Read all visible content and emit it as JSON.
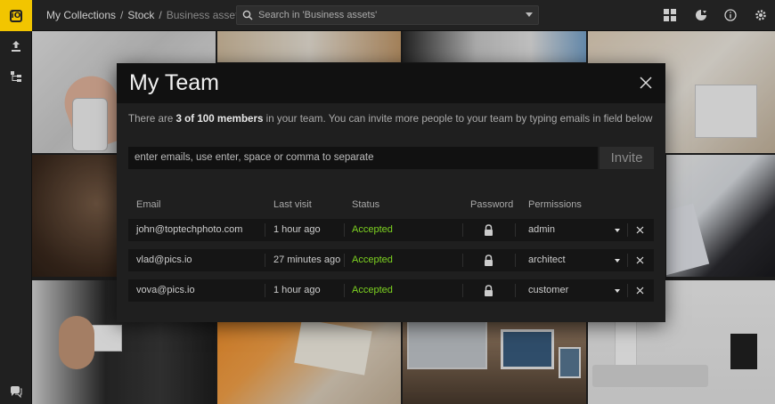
{
  "topbar": {
    "logo_text": "iO",
    "breadcrumb": [
      "My Collections",
      "Stock",
      "Business assets"
    ],
    "breadcrumb_sep": "/",
    "search_placeholder": "Search in 'Business assets'",
    "icons": [
      "grid-view-icon",
      "sort-icon",
      "info-icon",
      "settings-gear-icon"
    ]
  },
  "sidebar": {
    "icons": [
      "upload-icon",
      "tree-icon",
      "chat-icon"
    ]
  },
  "modal": {
    "title": "My Team",
    "intro_prefix": "There are ",
    "intro_count": "3 of 100 members",
    "intro_suffix": " in your team. You can invite more people to your team by typing emails in field below",
    "input_placeholder": "enter emails, use enter, space or comma to separate",
    "invite_label": "Invite",
    "columns": [
      "Email",
      "Last visit",
      "Status",
      "Password",
      "Permissions"
    ],
    "members": [
      {
        "email": "john@toptechphoto.com",
        "last_visit": "1 hour ago",
        "status": "Accepted",
        "permission": "admin"
      },
      {
        "email": "vlad@pics.io",
        "last_visit": "27 minutes ago",
        "status": "Accepted",
        "permission": "architect"
      },
      {
        "email": "vova@pics.io",
        "last_visit": "1 hour ago",
        "status": "Accepted",
        "permission": "customer"
      }
    ]
  },
  "colors": {
    "accent": "#f2c500",
    "status_accepted": "#7ed321"
  }
}
